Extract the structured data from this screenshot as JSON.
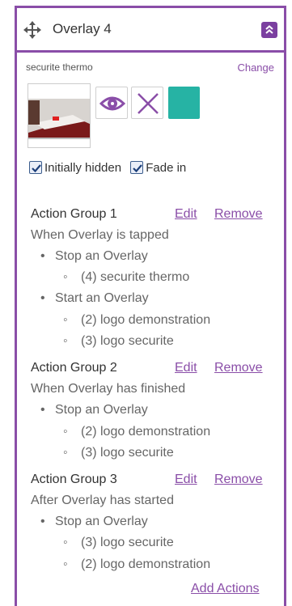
{
  "overlay": {
    "title": "Overlay 4",
    "media_name": "securite thermo",
    "change_label": "Change",
    "swatch_color": "#26b3a4",
    "accent_color": "#8a4ea8",
    "icons": [
      "move-icon",
      "chevron-up-icon",
      "eye-icon",
      "close-icon"
    ]
  },
  "options": {
    "initially_hidden": {
      "label": "Initially hidden",
      "checked": true
    },
    "fade_in": {
      "label": "Fade in",
      "checked": true
    }
  },
  "action_groups": [
    {
      "title": "Action Group 1",
      "edit_label": "Edit",
      "remove_label": "Remove",
      "trigger": "When Overlay is tapped",
      "actions": [
        {
          "label": "Stop an Overlay",
          "items": [
            "(4) securite thermo"
          ]
        },
        {
          "label": "Start an Overlay",
          "items": [
            "(2) logo demonstration",
            "(3) logo securite"
          ]
        }
      ]
    },
    {
      "title": "Action Group 2",
      "edit_label": "Edit",
      "remove_label": "Remove",
      "trigger": "When Overlay has finished",
      "actions": [
        {
          "label": "Stop an Overlay",
          "items": [
            "(2) logo demonstration",
            "(3) logo securite"
          ]
        }
      ]
    },
    {
      "title": "Action Group 3",
      "edit_label": "Edit",
      "remove_label": "Remove",
      "trigger": "After Overlay has started",
      "actions": [
        {
          "label": "Stop an Overlay",
          "items": [
            "(3) logo securite",
            "(2) logo demonstration"
          ]
        }
      ]
    }
  ],
  "add_actions_label": "Add Actions"
}
